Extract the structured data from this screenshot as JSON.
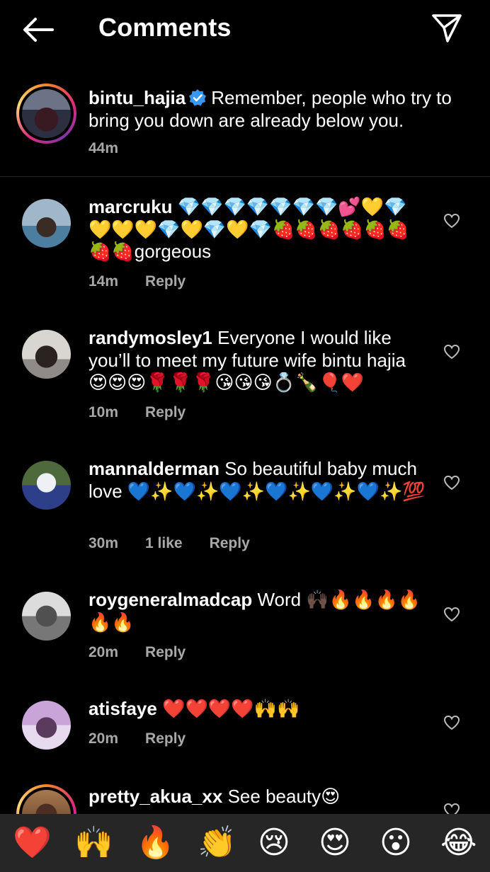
{
  "header": {
    "title": "Comments"
  },
  "caption": {
    "username": "bintu_hajia",
    "text": "Remember, people who try to bring you down are already below you.",
    "time": "44m"
  },
  "comments": [
    {
      "username": "marcruku",
      "text": "💎💎💎💎💎💎💎💕💛💎💛💛💛💎💛💎💛💎🍓🍓🍓🍓🍓🍓🍓🍓gorgeous",
      "time": "14m",
      "reply": "Reply"
    },
    {
      "username": "randymosley1",
      "text": "Everyone I would like you’ll to meet my future wife bintu hajia 😍😍😍🌹🌹🌹😘😘😘💍🍾🎈❤️",
      "time": "10m",
      "reply": "Reply"
    },
    {
      "username": "mannalderman",
      "text": "So beautiful baby much love 💙✨💙✨💙✨💙✨💙✨💙✨💯",
      "time": "30m",
      "likes": "1 like",
      "reply": "Reply"
    },
    {
      "username": "roygeneralmadcap",
      "text": "Word 🙌🏿🔥🔥🔥🔥🔥🔥",
      "time": "20m",
      "reply": "Reply"
    },
    {
      "username": "atisfaye",
      "text": "❤️❤️❤️❤️🙌🙌",
      "time": "20m",
      "reply": "Reply"
    },
    {
      "username": "pretty_akua_xx",
      "text": "See beauty😍"
    }
  ],
  "quick_reactions": [
    "❤️",
    "🙌",
    "🔥",
    "👏",
    "😢",
    "😍",
    "😮",
    "😂"
  ]
}
